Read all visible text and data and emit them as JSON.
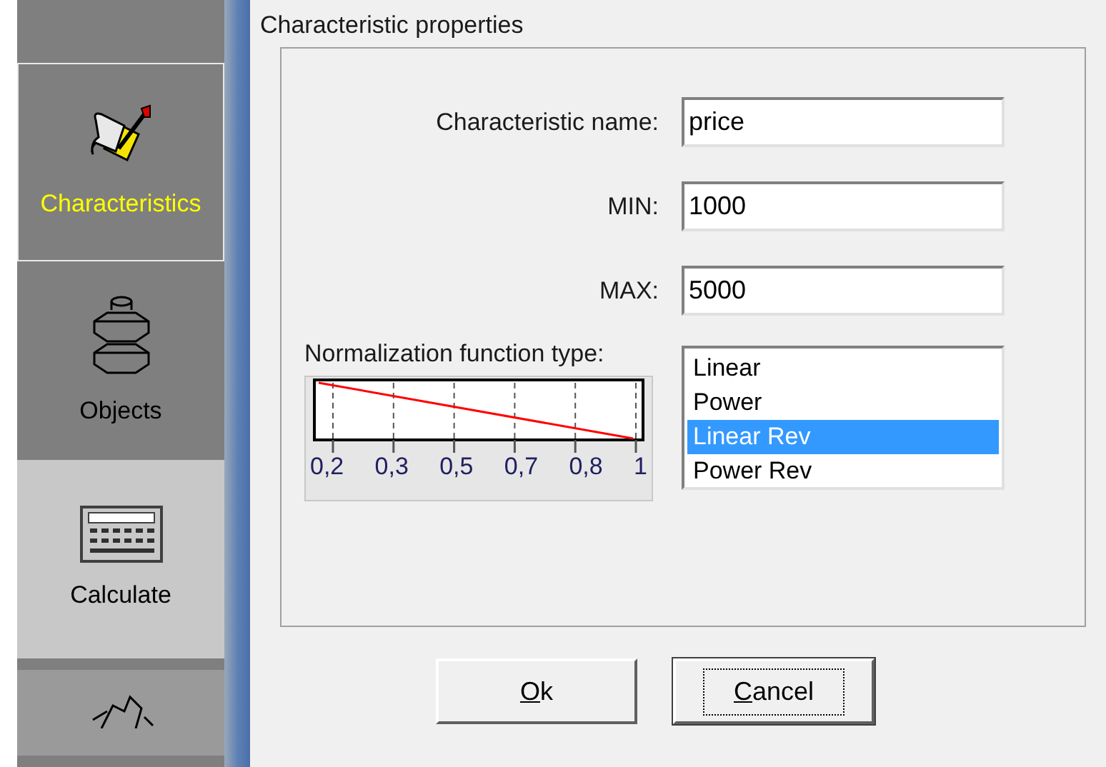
{
  "sidebar": {
    "items": [
      {
        "label": "Characteristics",
        "kind": "scroll",
        "selected": true,
        "hovered": false
      },
      {
        "label": "Objects",
        "kind": "nuts",
        "selected": false,
        "hovered": false
      },
      {
        "label": "Calculate",
        "kind": "calculator",
        "selected": false,
        "hovered": true
      },
      {
        "kind": "arrows",
        "selected": false,
        "hovered": false
      }
    ]
  },
  "dialog": {
    "title": "Characteristic properties",
    "fields": [
      {
        "label": "Characteristic name:",
        "value": "price"
      },
      {
        "label": "MIN:",
        "value": "1000"
      },
      {
        "label": "MAX:",
        "value": "5000"
      }
    ],
    "normalization": {
      "label": "Normalization function type:",
      "tick_labels": [
        "0,2",
        "0,3",
        "0,5",
        "0,7",
        "0,8",
        "1"
      ],
      "options": [
        {
          "label": "Linear",
          "selected": false
        },
        {
          "label": "Power",
          "selected": false
        },
        {
          "label": "Linear Rev",
          "selected": true
        },
        {
          "label": "Power Rev",
          "selected": false
        }
      ]
    },
    "buttons": [
      {
        "label": "Ok",
        "mnemonic": true,
        "focused": false
      },
      {
        "label": "Cancel",
        "mnemonic": true,
        "focused": true
      }
    ]
  }
}
